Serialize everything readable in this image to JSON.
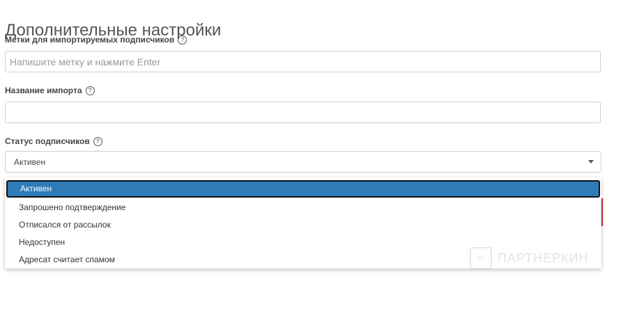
{
  "section": {
    "title": "Дополнительные настройки"
  },
  "tags": {
    "label": "Метки для импортируемых подписчиков",
    "placeholder": "Напишите метку и нажмите Enter"
  },
  "import_name": {
    "label": "Название импорта",
    "value": ""
  },
  "status": {
    "label": "Статус подписчиков",
    "selected": "Активен",
    "options": [
      "Активен",
      "Запрошено подтверждение",
      "Отписался от рассылок",
      "Недоступен",
      "Адресат считает спамом"
    ]
  },
  "help_icon_glyph": "?",
  "watermark": {
    "text": "ПАРТНЕРКИН"
  },
  "colors": {
    "selected_option_bg": "#2e7bb8",
    "accent_red": "#c62828"
  }
}
